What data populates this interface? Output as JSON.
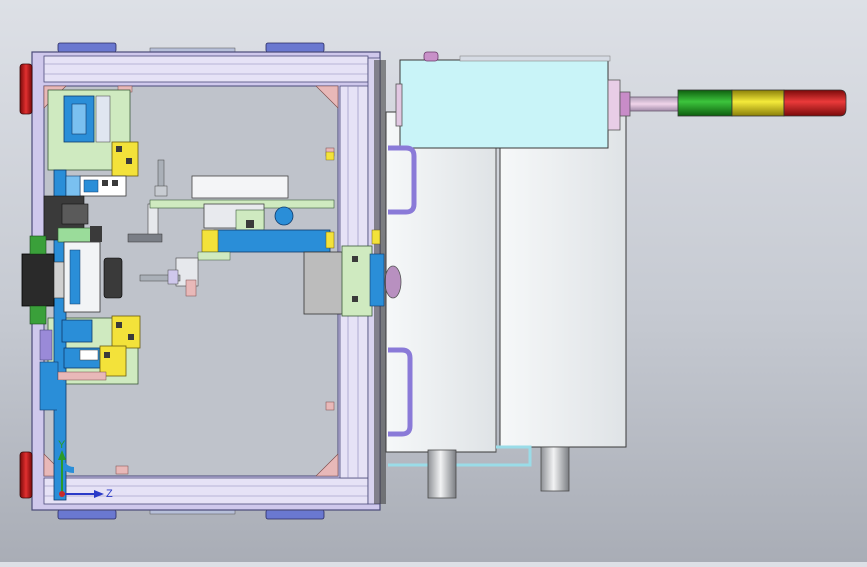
{
  "viewport": {
    "view": "top-view",
    "axis_triad": {
      "vertical_axis": "Y",
      "horizontal_axis": "Z"
    }
  },
  "colors": {
    "background_top": "#dde0e6",
    "background_bottom": "#a9adb6",
    "frame_outer": "#cfc8ec",
    "frame_inner": "#e6e2f6",
    "frame_edge": "#4a4a78",
    "cabinet": "#eef2f4",
    "cabinet_cap": "#c9f4f8",
    "blue_parts": "#2a8ed8",
    "yellow_parts": "#f3e23a",
    "green_parts": "#cfeac0",
    "red_pads": "#cc2020",
    "tower_green": "#28a628",
    "tower_yellow": "#e4d81c",
    "tower_red": "#d02626",
    "pipe": "#9c90e0"
  },
  "signal_tower": {
    "segments": [
      "green",
      "yellow",
      "red"
    ]
  }
}
